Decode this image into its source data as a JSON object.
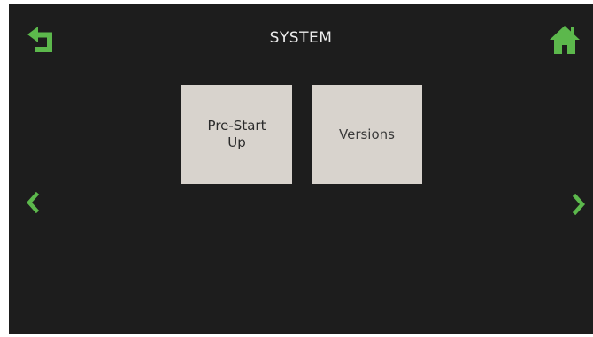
{
  "header": {
    "title": "SYSTEM",
    "back_icon": "back-arrow-icon",
    "home_icon": "home-icon"
  },
  "tiles": [
    {
      "label": "Pre-Start\nUp"
    },
    {
      "label": "Versions"
    }
  ],
  "navigation": {
    "prev_icon": "chevron-left-icon",
    "next_icon": "chevron-right-icon"
  },
  "colors": {
    "background": "#1d1d1d",
    "accent": "#5cb84c",
    "tile": "#d8d3cd",
    "title_text": "#ececec"
  }
}
